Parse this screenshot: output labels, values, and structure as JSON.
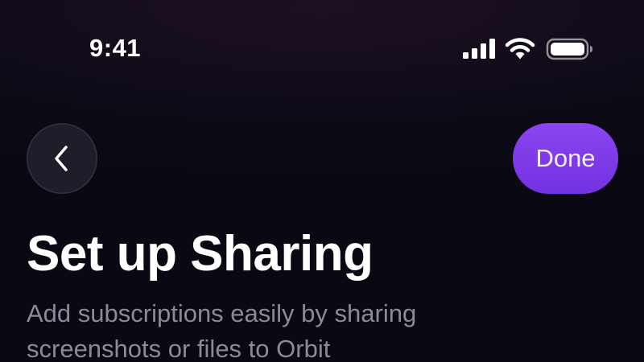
{
  "status_bar": {
    "time": "9:41",
    "icons": [
      "cellular-signal-icon",
      "wifi-icon",
      "battery-icon"
    ]
  },
  "nav": {
    "back_icon": "chevron-left-icon",
    "done_label": "Done"
  },
  "header": {
    "title": "Set up Sharing",
    "subtitle_lines": [
      "Add subscriptions easily by sharing",
      "screenshots or files to Orbit"
    ]
  },
  "colors": {
    "background": "#0b0914",
    "accent": "#7c3aed",
    "title_text": "#ffffff",
    "subtitle_text": "#8d8a98",
    "back_button_bg": "#1f1d29"
  }
}
